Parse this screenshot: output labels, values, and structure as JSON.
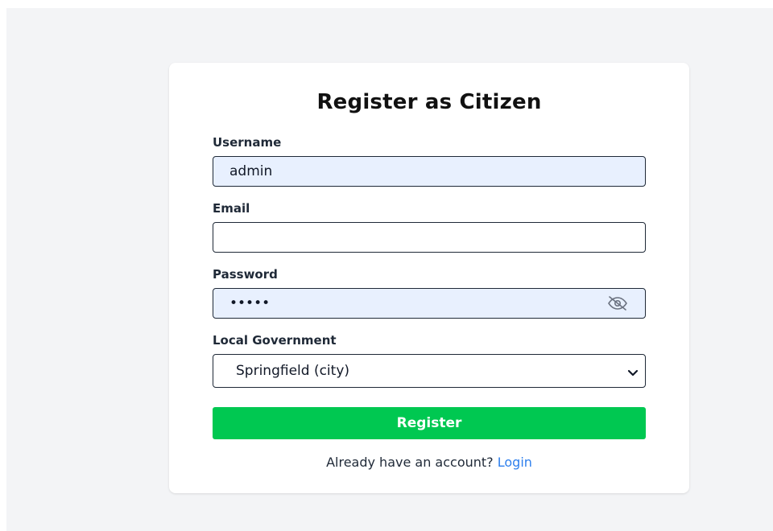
{
  "form": {
    "title": "Register as Citizen",
    "username": {
      "label": "Username",
      "value": "admin"
    },
    "email": {
      "label": "Email",
      "value": ""
    },
    "password": {
      "label": "Password",
      "value": "admin",
      "toggle_icon": "eye-slash-icon"
    },
    "local_government": {
      "label": "Local Government",
      "selected": "Springfield (city)",
      "icon": "chevron-down-icon"
    },
    "register_label": "Register",
    "footer": {
      "prompt": "Already have an account? ",
      "login_label": "Login"
    }
  },
  "colors": {
    "page_background": "#f3f4f6",
    "card_background": "#ffffff",
    "autofill_background": "#e8f0fe",
    "primary_button": "#00c851",
    "link": "#2f80ed"
  }
}
